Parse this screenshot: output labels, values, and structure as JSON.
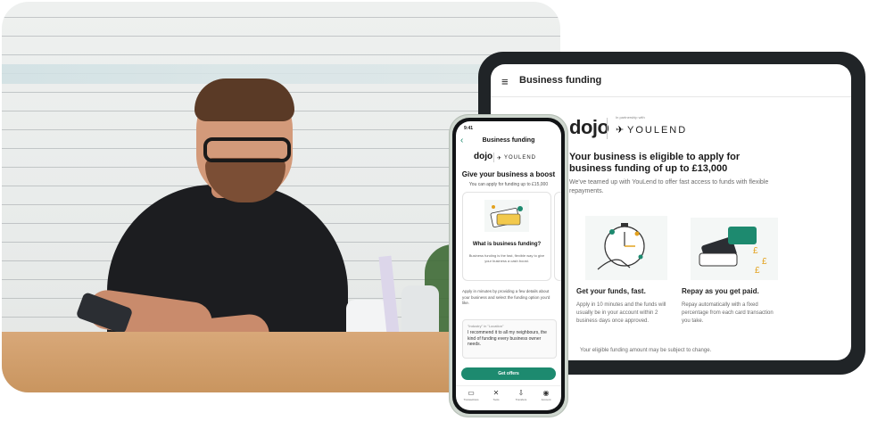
{
  "tablet": {
    "menu_icon": "hamburger-menu-icon",
    "menu_glyph": "≡",
    "header_title": "Business funding",
    "dojo_logo": "dojo",
    "powered_by": "In partnership with",
    "youlend_glyph": "✈",
    "youlend_logo": "YOULEND",
    "heading": "Your business is eligible to apply for business funding of up to £13,000",
    "intro": "We've teamed up with YouLend to offer fast access to funds with flexible repayments.",
    "feature1_title": "Get your funds, fast.",
    "feature1_desc": "Apply in 10 minutes and the funds will usually be in your account within 2 business days once approved.",
    "feature2_title": "Repay as you get paid.",
    "feature2_desc": "Repay automatically with a fixed percentage from each card transaction you take.",
    "note": "Your eligible funding amount may be subject to change."
  },
  "phone": {
    "time": "9:41",
    "back_glyph": "‹",
    "header_title": "Business funding",
    "dojo_logo": "dojo",
    "youlend_glyph": "✈",
    "youlend_logo": "YOULEND",
    "heading": "Give your business a boost",
    "subheading": "You can apply for funding up to £15,000",
    "card_title": "What is business funding?",
    "card_text": "Business funding is the fast, flexible way to give your business a cash boost.",
    "apply_text": "Apply in minutes by providing a few details about your business and select the funding option you'd like.",
    "quote_source": "\"Industry\" in \"Location\"",
    "quote_text": "I recommend it to all my neighbours, the kind of funding every business owner needs.",
    "cta": "Get offers",
    "nav": [
      {
        "icon": "card-icon",
        "glyph": "▭",
        "label": "Transactions"
      },
      {
        "icon": "tools-icon",
        "glyph": "✕",
        "label": "Tools"
      },
      {
        "icon": "transfer-icon",
        "glyph": "⇩",
        "label": "Transfers"
      },
      {
        "icon": "account-icon",
        "glyph": "◉",
        "label": "Account"
      }
    ]
  },
  "colors": {
    "brand_green": "#1d8a6f",
    "device_dark": "#202427",
    "phone_frame": "#cfd7cf"
  }
}
